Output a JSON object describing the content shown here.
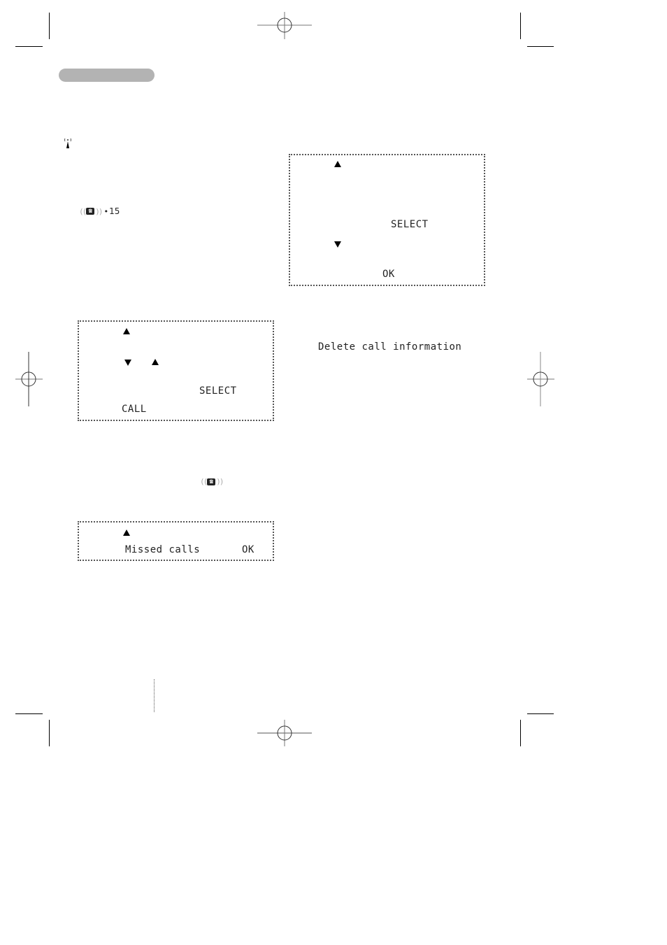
{
  "header": {
    "bar_color": "#b3b3b3"
  },
  "icons": {
    "antenna": "antenna-signal-icon",
    "ringing_phone": "ringing-phone-icon",
    "ringing_phone_count": "15"
  },
  "lcd_call_list": {
    "softkey_right": "SELECT",
    "softkey_left": "CALL"
  },
  "lcd_missed_calls": {
    "item_label": "Missed calls",
    "softkey_right": "OK"
  },
  "lcd_right_menu": {
    "softkey_select": "SELECT",
    "softkey_ok": "OK"
  },
  "right_text": {
    "delete_call_information": "Delete call information"
  }
}
